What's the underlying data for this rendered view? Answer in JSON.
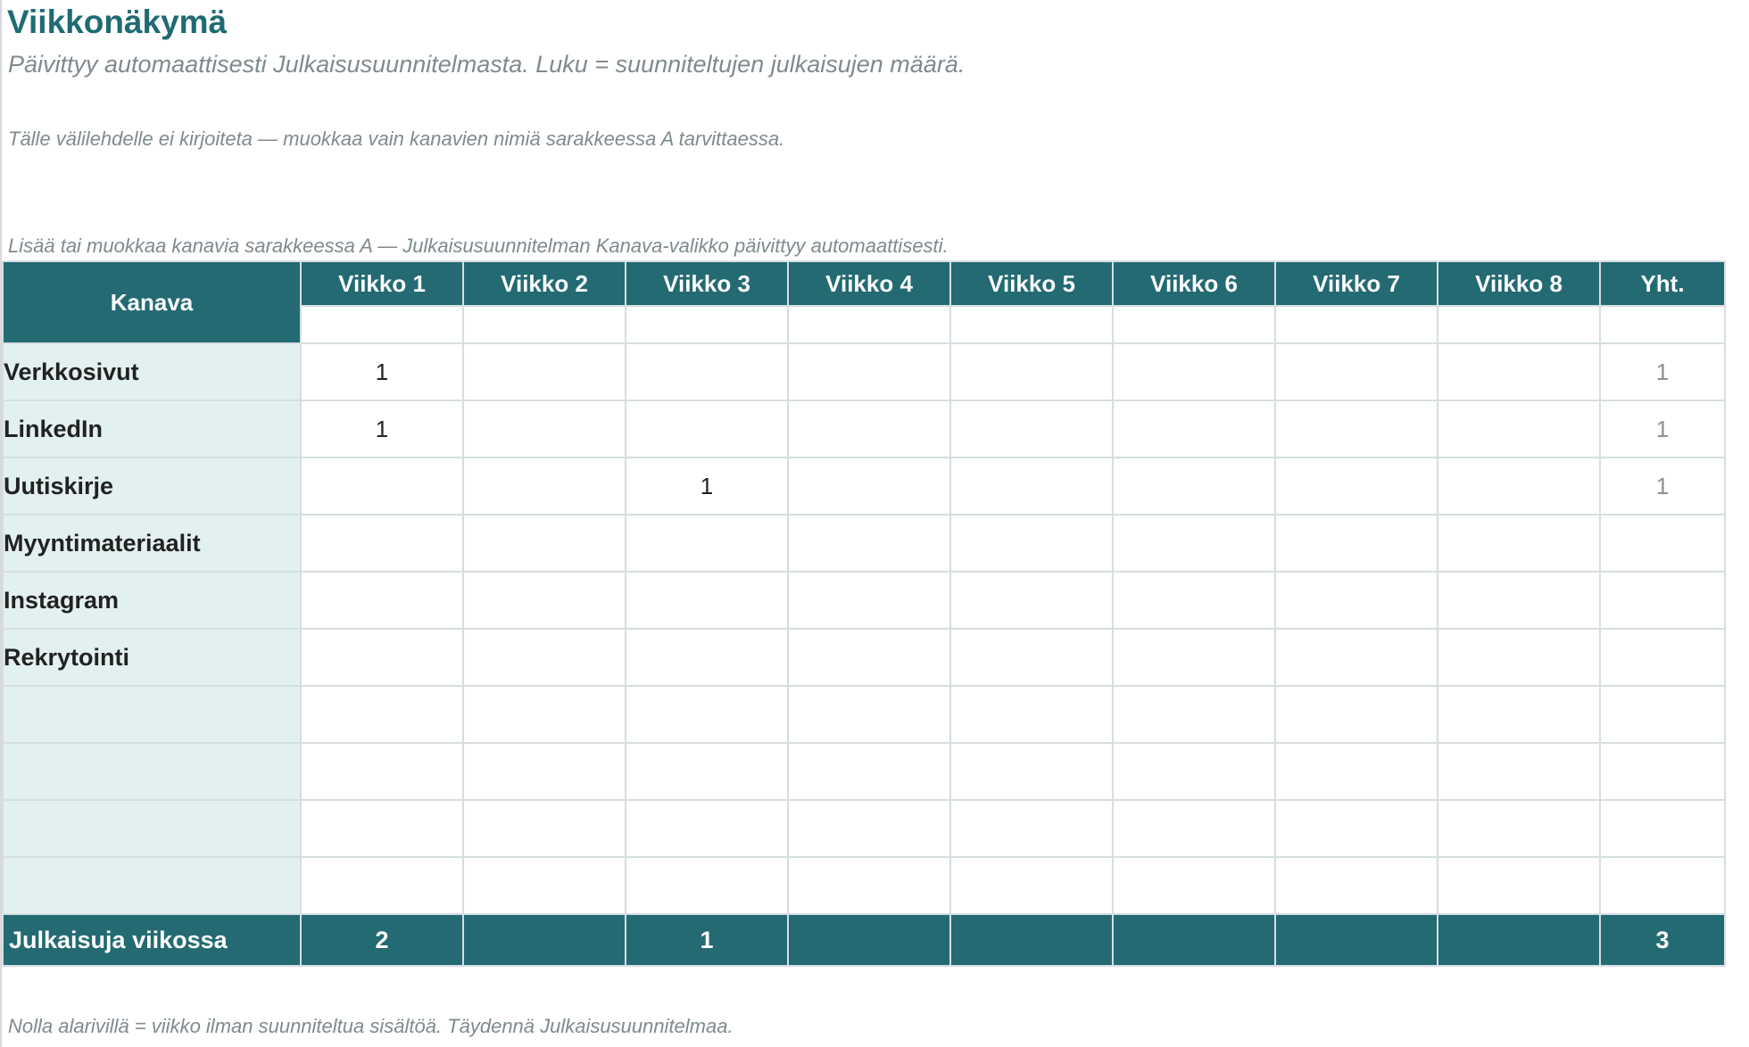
{
  "page": {
    "title": "Viikkonäkymä",
    "subtitle": "Päivittyy automaattisesti Julkaisusuunnitelmasta. Luku = suunniteltujen julkaisujen määrä.",
    "note_top": "Tälle välilehdelle ei kirjoiteta — muokkaa vain kanavien nimiä sarakkeessa A tarvittaessa.",
    "note_above_table": "Lisää tai muokkaa kanavia sarakkeessa A — Julkaisusuunnitelman Kanava-valikko päivittyy automaattisesti.",
    "note_bottom": "Nolla alarivillä = viikko ilman suunniteltua sisältöä. Täydennä Julkaisusuunnitelmaa."
  },
  "table": {
    "channel_header": "Kanava",
    "week_headers": [
      "Viikko 1",
      "Viikko 2",
      "Viikko 3",
      "Viikko 4",
      "Viikko 5",
      "Viikko 6",
      "Viikko 7",
      "Viikko 8"
    ],
    "total_header": "Yht.",
    "rows": [
      {
        "channel": "Verkkosivut",
        "weeks": [
          "1",
          "",
          "",
          "",
          "",
          "",
          "",
          ""
        ],
        "total": "1"
      },
      {
        "channel": "LinkedIn",
        "weeks": [
          "1",
          "",
          "",
          "",
          "",
          "",
          "",
          ""
        ],
        "total": "1"
      },
      {
        "channel": "Uutiskirje",
        "weeks": [
          "",
          "",
          "1",
          "",
          "",
          "",
          "",
          ""
        ],
        "total": "1"
      },
      {
        "channel": "Myyntimateriaalit",
        "weeks": [
          "",
          "",
          "",
          "",
          "",
          "",
          "",
          ""
        ],
        "total": ""
      },
      {
        "channel": "Instagram",
        "weeks": [
          "",
          "",
          "",
          "",
          "",
          "",
          "",
          ""
        ],
        "total": ""
      },
      {
        "channel": "Rekrytointi",
        "weeks": [
          "",
          "",
          "",
          "",
          "",
          "",
          "",
          ""
        ],
        "total": ""
      },
      {
        "channel": "",
        "weeks": [
          "",
          "",
          "",
          "",
          "",
          "",
          "",
          ""
        ],
        "total": ""
      },
      {
        "channel": "",
        "weeks": [
          "",
          "",
          "",
          "",
          "",
          "",
          "",
          ""
        ],
        "total": ""
      },
      {
        "channel": "",
        "weeks": [
          "",
          "",
          "",
          "",
          "",
          "",
          "",
          ""
        ],
        "total": ""
      },
      {
        "channel": "",
        "weeks": [
          "",
          "",
          "",
          "",
          "",
          "",
          "",
          ""
        ],
        "total": ""
      }
    ],
    "footer": {
      "label": "Julkaisuja viikossa",
      "weeks": [
        "2",
        "",
        "1",
        "",
        "",
        "",
        "",
        ""
      ],
      "total": "3"
    }
  },
  "colors": {
    "header_bg": "#236a73",
    "title": "#1f6b73",
    "channel_bg": "#e3f0f0",
    "note": "#7f8a8f"
  }
}
